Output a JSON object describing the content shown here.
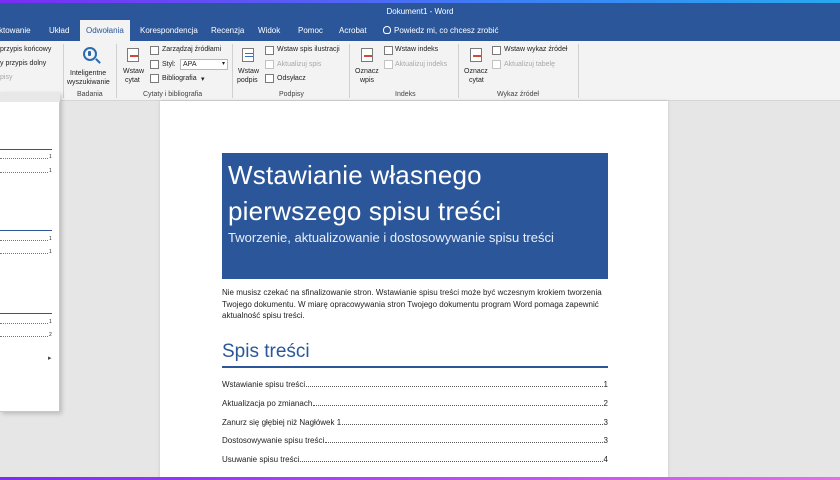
{
  "window": {
    "title": "Dokument1 - Word"
  },
  "tabs": [
    {
      "label": "ktowanie",
      "active": false
    },
    {
      "label": "Układ",
      "active": false
    },
    {
      "label": "Odwołania",
      "active": true
    },
    {
      "label": "Korespondencja",
      "active": false
    },
    {
      "label": "Recenzja",
      "active": false
    },
    {
      "label": "Widok",
      "active": false
    },
    {
      "label": "Pomoc",
      "active": false
    },
    {
      "label": "Acrobat",
      "active": false
    }
  ],
  "tell_me": "Powiedz mi, co chcesz zrobić",
  "ribbon": {
    "footnotes": {
      "endnote": "przypis końcowy",
      "next_footnote": "y przypis dolny",
      "show_notes": "pisy",
      "more": "ypisy"
    },
    "research": {
      "smart_lookup_line1": "Inteligentne",
      "smart_lookup_line2": "wyszukiwanie",
      "group": "Badania"
    },
    "citations": {
      "insert_line1": "Wstaw",
      "insert_line2": "cytat",
      "manage_sources": "Zarządzaj źródłami",
      "style_label": "Styl:",
      "style_value": "APA",
      "bibliography": "Bibliografia",
      "group": "Cytaty i bibliografia"
    },
    "captions": {
      "insert_line1": "Wstaw",
      "insert_line2": "podpis",
      "insert_table_of_figures": "Wstaw spis ilustracji",
      "update_table": "Aktualizuj spis",
      "cross_reference": "Odsyłacz",
      "group": "Podpisy"
    },
    "index": {
      "mark_line1": "Oznacz",
      "mark_line2": "wpis",
      "insert_index": "Wstaw indeks",
      "update_index": "Aktualizuj indeks",
      "group": "Indeks"
    },
    "authorities": {
      "mark_line1": "Oznacz",
      "mark_line2": "cytat",
      "insert_table": "Wstaw wykaz źródeł",
      "update_table": "Aktualizuj tabelę",
      "group": "Wykaz źródeł"
    }
  },
  "panel_numbers": [
    "1",
    "1",
    "1",
    "1",
    "1",
    "2"
  ],
  "document": {
    "cover_title": "Wstawianie własnego pierwszego spisu treści",
    "cover_subtitle": "Tworzenie, aktualizowanie i dostosowywanie spisu treści",
    "intro": "Nie musisz czekać na sfinalizowanie stron. Wstawianie spisu treści może być wczesnym krokiem tworzenia Twojego dokumentu. W miarę opracowywania stron Twojego dokumentu program Word pomaga zapewnić aktualność spisu treści.",
    "toc_heading": "Spis treści",
    "toc": [
      {
        "text": "Wstawianie spisu treści",
        "page": "1"
      },
      {
        "text": "Aktualizacja po zmianach",
        "page": "2"
      },
      {
        "text": "Zanurz się głębiej niż Nagłówek 1",
        "page": "3"
      },
      {
        "text": "Dostosowywanie spisu treści",
        "page": "3"
      },
      {
        "text": "Usuwanie spisu treści",
        "page": "4"
      }
    ]
  },
  "colors": {
    "accent": "#2b579a",
    "ribbon_bg": "#f3f3f3"
  }
}
